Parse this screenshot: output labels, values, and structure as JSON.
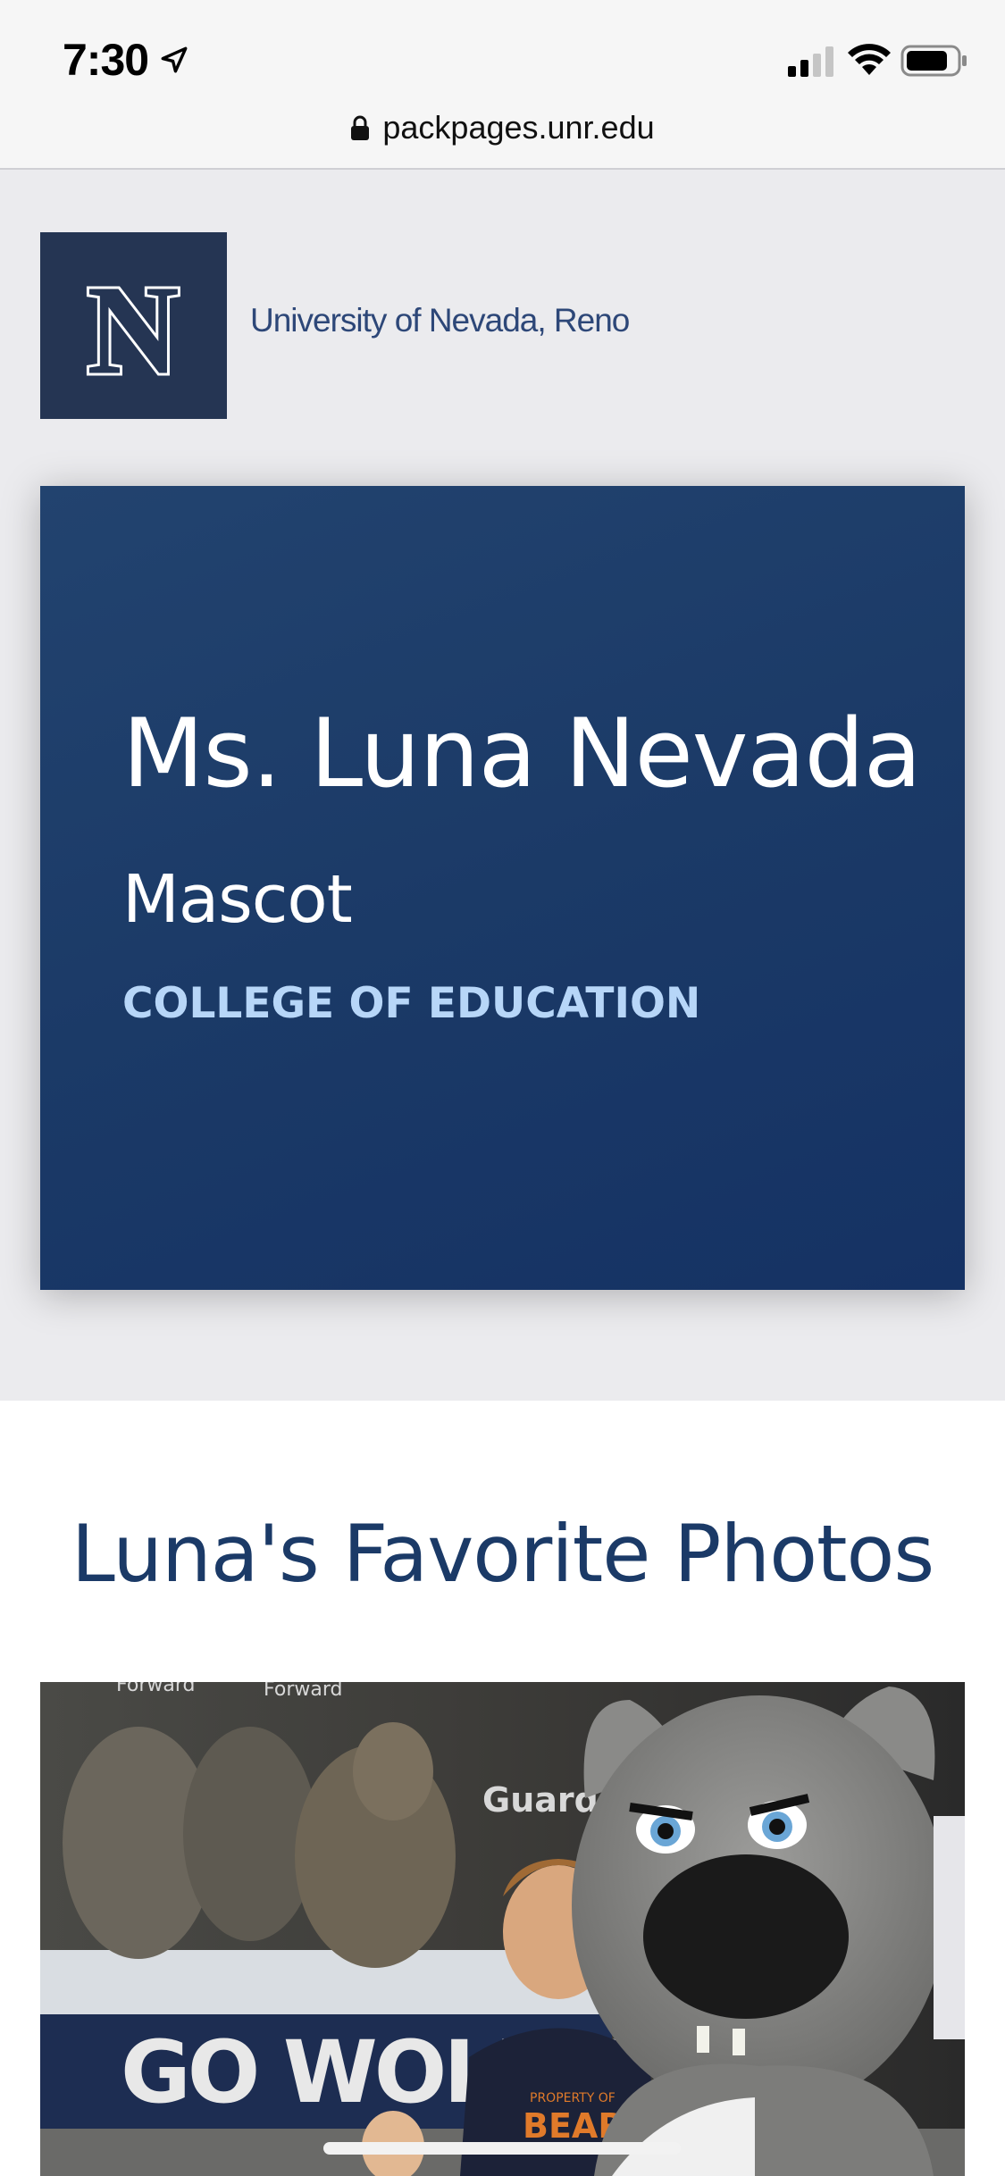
{
  "status_bar": {
    "time": "7:30",
    "icons": [
      "location-arrow-icon",
      "signal-icon",
      "wifi-icon",
      "battery-icon"
    ]
  },
  "browser": {
    "url": "packpages.unr.edu",
    "lock_icon": "lock-icon"
  },
  "header": {
    "logo_letter": "N",
    "university_name": "University of Nevada, Reno"
  },
  "profile": {
    "name": "Ms. Luna Nevada",
    "title": "Mascot",
    "college": "COLLEGE OF EDUCATION"
  },
  "photos": {
    "heading": "Luna's Favorite Photos",
    "image_text": {
      "banner": "GO WOLF P",
      "label_forward_1": "Forward",
      "label_forward_2": "Forward",
      "label_guard": "Guard",
      "shirt": "PROPERTY OF BEARS"
    }
  },
  "colors": {
    "navy": "#1b3a67",
    "logo_bg": "#253553",
    "college_text": "#b7d6f8",
    "page_bg": "#ebebee"
  }
}
